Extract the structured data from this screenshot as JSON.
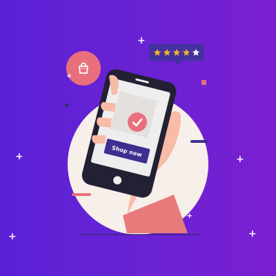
{
  "illustration": {
    "cta": {
      "label": "Shop now"
    },
    "rating": {
      "stars_filled": 4,
      "stars_total": 5
    },
    "icons": {
      "shopping_bag": "shopping-bag-icon",
      "confirmation": "check-icon",
      "rating": "star-icon",
      "sparkle": "sparkle-icon"
    },
    "colors": {
      "background": "#6622d4",
      "circle": "#f7efe9",
      "phone": "#222033",
      "screen": "#eeeeee",
      "accent": "#e8707e",
      "button": "#3f2f90",
      "star_filled": "#f5b32a",
      "star_empty": "#ffffff",
      "hand": "#f7bba8",
      "sleeve": "#e97a7c"
    }
  }
}
